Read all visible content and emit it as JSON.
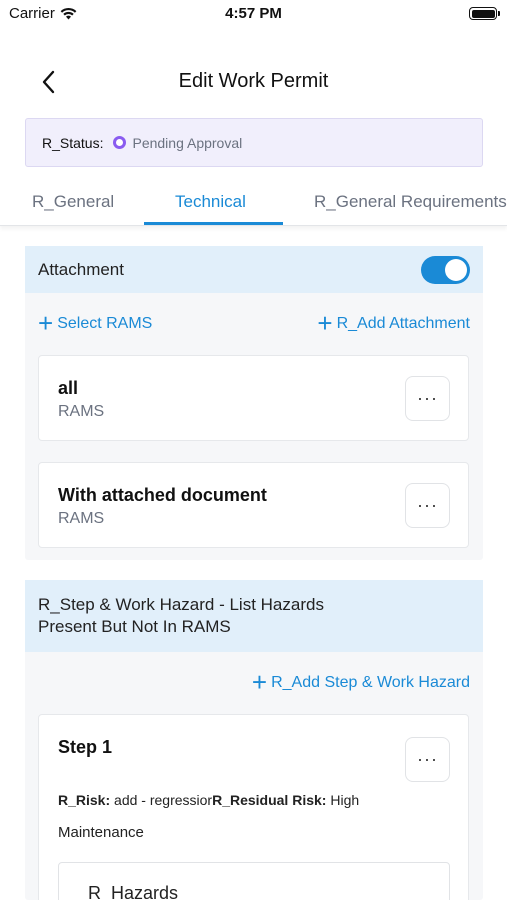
{
  "status_bar": {
    "carrier": "Carrier",
    "time": "4:57 PM"
  },
  "nav": {
    "title": "Edit Work Permit",
    "back_icon": "chevron-left-icon"
  },
  "status": {
    "label": "R_Status:",
    "value": "Pending Approval",
    "dot_color": "#8a5cf0"
  },
  "tabs": [
    {
      "label": "R_General"
    },
    {
      "label": "Technical",
      "active": true
    },
    {
      "label": "R_General Requirements"
    }
  ],
  "attachment": {
    "title": "Attachment",
    "toggle_on": true,
    "select_rams": "Select RAMS",
    "add_attachment": "R_Add Attachment",
    "items": [
      {
        "title": "all",
        "subtitle": "RAMS",
        "more": "···"
      },
      {
        "title": "With attached document",
        "subtitle": "RAMS",
        "more": "···"
      }
    ]
  },
  "hazard_section": {
    "title_line1": "R_Step & Work Hazard - List Hazards",
    "title_line2": "Present But Not In RAMS",
    "add_step": "R_Add Step & Work Hazard",
    "step": {
      "title": "Step 1",
      "more": "···",
      "risk_label": "R_Risk:",
      "risk_value": "add - regressior",
      "residual_label": "R_Residual Risk:",
      "residual_value": "High",
      "category": "Maintenance",
      "hazards_label": "R_Hazards"
    }
  },
  "colors": {
    "accent": "#1a8ad6",
    "header_bg": "#e1effa",
    "status_bg": "#f1effc"
  }
}
